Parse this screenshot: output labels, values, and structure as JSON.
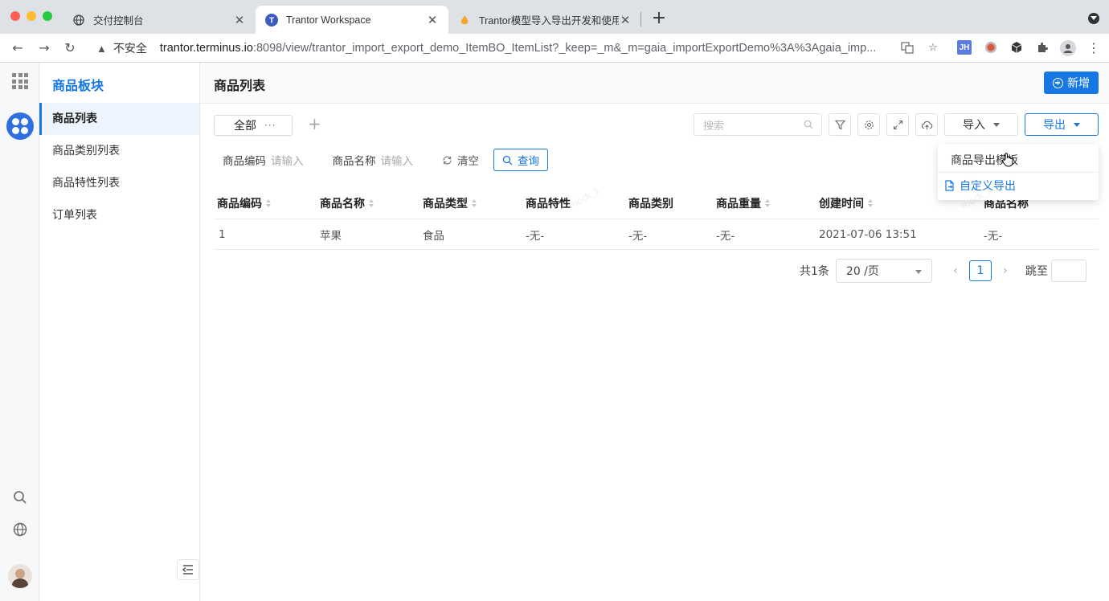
{
  "browser": {
    "tabs": [
      {
        "title": "交付控制台",
        "icon": "globe-icon"
      },
      {
        "title": "Trantor Workspace",
        "icon": "trantor-icon"
      },
      {
        "title": "Trantor模型导入导出开发和使用",
        "icon": "flame-icon"
      }
    ],
    "address": {
      "security": "不安全",
      "host": "trantor.terminus.io",
      "path": ":8098/view/trantor_import_export_demo_ItemBO_ItemList?_keep=_m&_m=gaia_importExportDemo%3A%3Agaia_imp..."
    },
    "extension_badge": "JH"
  },
  "sidebar": {
    "module_title": "商品板块",
    "items": [
      {
        "label": "商品列表"
      },
      {
        "label": "商品类别列表"
      },
      {
        "label": "商品特性列表"
      },
      {
        "label": "订单列表"
      }
    ]
  },
  "page": {
    "title": "商品列表",
    "new_button": "新增",
    "view_tab": "全部",
    "view_tab_more": "···",
    "add_view": "+",
    "search_placeholder": "搜索",
    "import_button": "导入",
    "export_button": "导出",
    "export_menu": {
      "template": "商品导出模板",
      "custom": "自定义导出"
    }
  },
  "filters": {
    "code_label": "商品编码",
    "code_placeholder": "请输入",
    "name_label": "商品名称",
    "name_placeholder": "请输入",
    "clear": "清空",
    "query": "查询"
  },
  "table": {
    "columns": [
      "商品编码",
      "商品名称",
      "商品类型",
      "商品特性",
      "商品类别",
      "商品重量",
      "创建时间",
      "商品名称"
    ],
    "rows": [
      [
        "1",
        "苹果",
        "食品",
        "-无-",
        "-无-",
        "-无-",
        "2021-07-06 13:51",
        "-无-"
      ]
    ]
  },
  "pagination": {
    "total": "共1条",
    "page_size": "20 /页",
    "current": "1",
    "jump_label": "跳至"
  },
  "watermark": "mock_1",
  "colors": {
    "accent": "#1677e5",
    "active_bg": "#eef4fd"
  }
}
